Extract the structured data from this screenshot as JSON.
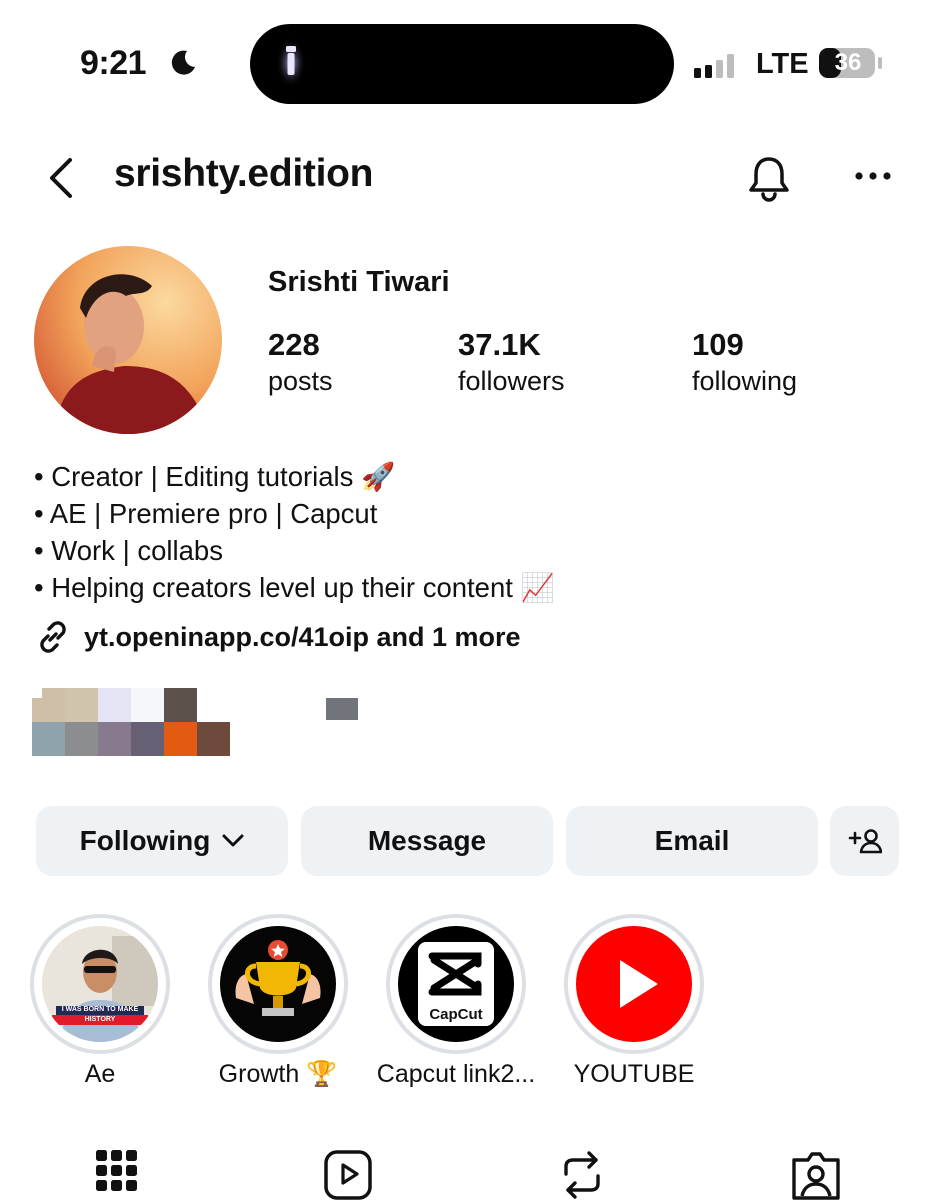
{
  "status_bar": {
    "time": "9:21",
    "network": "LTE",
    "battery": "36"
  },
  "header": {
    "username": "srishty.edition",
    "icons": [
      "back-icon",
      "bell-icon",
      "more-icon"
    ]
  },
  "profile": {
    "full_name": "Srishti Tiwari",
    "stats": [
      {
        "value": "228",
        "label": "posts"
      },
      {
        "value": "37.1K",
        "label": "followers"
      },
      {
        "value": "109",
        "label": "following"
      }
    ],
    "bio_lines": [
      "• Creator | Editing tutorials 🚀",
      "• AE | Premiere pro | Capcut",
      "• Work | collabs",
      "• Helping creators level up their content 📈"
    ],
    "link": "yt.openinapp.co/41oip and 1 more"
  },
  "actions": {
    "following": "Following",
    "message": "Message",
    "email": "Email"
  },
  "highlights": [
    {
      "label": "Ae",
      "inner_text": "I WAS BORN TO MAKE HISTORY"
    },
    {
      "label": "Growth 🏆"
    },
    {
      "label": "Capcut link2...",
      "inner_text": "CapCut"
    },
    {
      "label": "YOUTUBE"
    }
  ],
  "colors": {
    "button_bg": "#eff2f5",
    "youtube_red": "#ff0000",
    "trophy_gold": "#f2b705"
  }
}
